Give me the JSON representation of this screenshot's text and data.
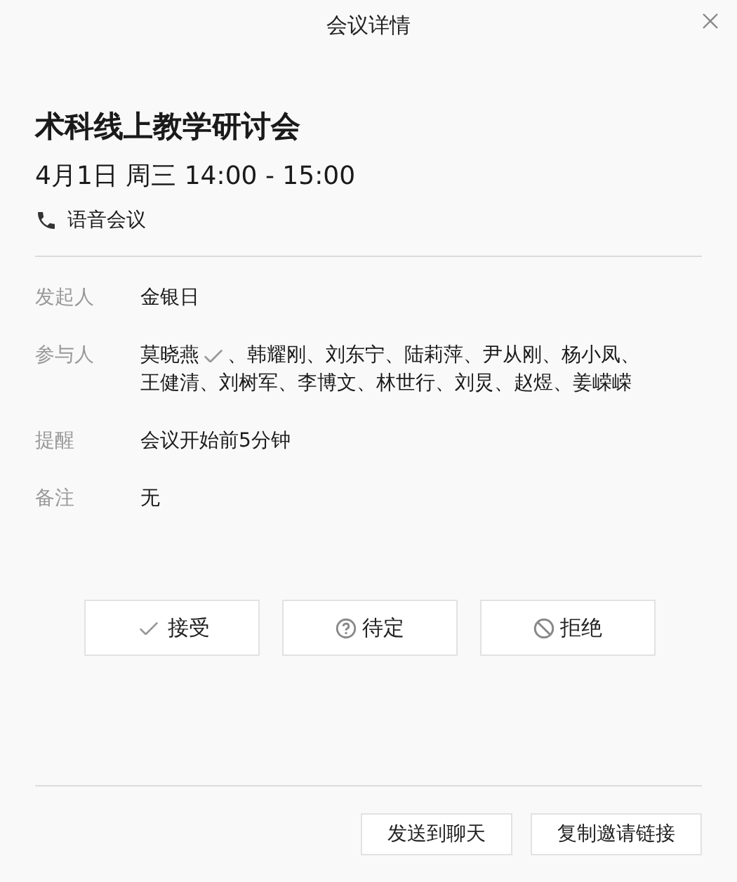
{
  "window": {
    "title": "会议详情"
  },
  "meeting": {
    "title": "术科线上教学研讨会",
    "time": "4月1日 周三 14:00 - 15:00",
    "type": "语音会议"
  },
  "fields": [
    {
      "kind": "text",
      "label": "发起人",
      "value": "金银日"
    },
    {
      "kind": "people",
      "label": "参与人",
      "separator": "、",
      "people": [
        {
          "name": "莫晓燕",
          "accepted": true
        },
        {
          "name": "韩耀刚",
          "accepted": false
        },
        {
          "name": "刘东宁",
          "accepted": false
        },
        {
          "name": "陆莉萍",
          "accepted": false
        },
        {
          "name": "尹从刚",
          "accepted": false
        },
        {
          "name": "杨小凤",
          "accepted": false
        },
        {
          "name": "王健清",
          "accepted": false
        },
        {
          "name": "刘树军",
          "accepted": false
        },
        {
          "name": "李博文",
          "accepted": false
        },
        {
          "name": "林世行",
          "accepted": false
        },
        {
          "name": "刘炅",
          "accepted": false
        },
        {
          "name": "赵煜",
          "accepted": false
        },
        {
          "name": "姜嵘嵘",
          "accepted": false
        }
      ]
    },
    {
      "kind": "text",
      "label": "提醒",
      "value": "会议开始前5分钟"
    },
    {
      "kind": "text",
      "label": "备注",
      "value": "无"
    }
  ],
  "responses": [
    {
      "kind": "accept",
      "label": "接受"
    },
    {
      "kind": "tentative",
      "label": "待定"
    },
    {
      "kind": "decline",
      "label": "拒绝"
    }
  ],
  "footer_buttons": [
    "发送到聊天",
    "复制邀请链接"
  ]
}
